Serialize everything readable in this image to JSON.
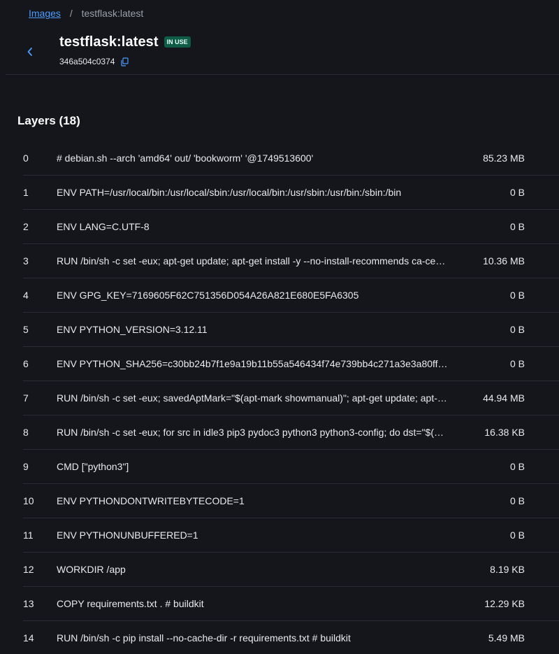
{
  "breadcrumb": {
    "root_label": "Images",
    "separator": "/",
    "current": "testflask:latest"
  },
  "header": {
    "title": "testflask:latest",
    "status_badge": "IN USE",
    "image_id": "346a504c0374",
    "back_icon": "chevron-left-icon",
    "copy_icon": "copy-icon"
  },
  "layers_section": {
    "title": "Layers (18)",
    "rows": [
      {
        "index": "0",
        "command": "# debian.sh --arch 'amd64' out/ 'bookworm' '@1749513600'",
        "size": "85.23 MB"
      },
      {
        "index": "1",
        "command": "ENV PATH=/usr/local/bin:/usr/local/sbin:/usr/local/bin:/usr/sbin:/usr/bin:/sbin:/bin",
        "size": "0 B"
      },
      {
        "index": "2",
        "command": "ENV LANG=C.UTF-8",
        "size": "0 B"
      },
      {
        "index": "3",
        "command": "RUN /bin/sh -c set -eux; apt-get update; apt-get install -y --no-install-recommends ca-ce…",
        "size": "10.36 MB"
      },
      {
        "index": "4",
        "command": "ENV GPG_KEY=7169605F62C751356D054A26A821E680E5FA6305",
        "size": "0 B"
      },
      {
        "index": "5",
        "command": "ENV PYTHON_VERSION=3.12.11",
        "size": "0 B"
      },
      {
        "index": "6",
        "command": "ENV PYTHON_SHA256=c30bb24b7f1e9a19b11b55a546434f74e739bb4c271a3e3a80ff…",
        "size": "0 B"
      },
      {
        "index": "7",
        "command": "RUN /bin/sh -c set -eux; savedAptMark=\"$(apt-mark showmanual)\"; apt-get update; apt-…",
        "size": "44.94 MB"
      },
      {
        "index": "8",
        "command": "RUN /bin/sh -c set -eux; for src in idle3 pip3 pydoc3 python3 python3-config; do dst=\"$(…",
        "size": "16.38 KB"
      },
      {
        "index": "9",
        "command": "CMD [\"python3\"]",
        "size": "0 B"
      },
      {
        "index": "10",
        "command": "ENV PYTHONDONTWRITEBYTECODE=1",
        "size": "0 B"
      },
      {
        "index": "11",
        "command": "ENV PYTHONUNBUFFERED=1",
        "size": "0 B"
      },
      {
        "index": "12",
        "command": "WORKDIR /app",
        "size": "8.19 KB"
      },
      {
        "index": "13",
        "command": "COPY requirements.txt . # buildkit",
        "size": "12.29 KB"
      },
      {
        "index": "14",
        "command": "RUN /bin/sh -c pip install --no-cache-dir -r requirements.txt # buildkit",
        "size": "5.49 MB"
      }
    ]
  },
  "colors": {
    "background": "#14161b",
    "link": "#4d9cff",
    "badge_bg": "#0d5c46",
    "divider": "#2a2d33"
  }
}
